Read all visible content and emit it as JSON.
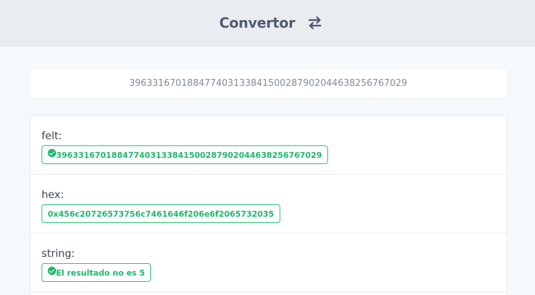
{
  "header": {
    "title": "Convertor",
    "icon": "swap-arrows-icon"
  },
  "input": {
    "value": "39633167018847740313384150028790204463825676702​9"
  },
  "results": [
    {
      "label": "felt:",
      "value": "39633167018847740313384150028790204463825676702​9",
      "valid": true
    },
    {
      "label": "hex:",
      "value": "0x456c20726573756c7461646f206e6f2065732035",
      "valid": false
    },
    {
      "label": "string:",
      "value": "El resultado no es 5",
      "valid": true
    }
  ],
  "colors": {
    "accent_green": "#1fb86c",
    "header_bg": "#e9edf0",
    "title": "#505a75"
  }
}
